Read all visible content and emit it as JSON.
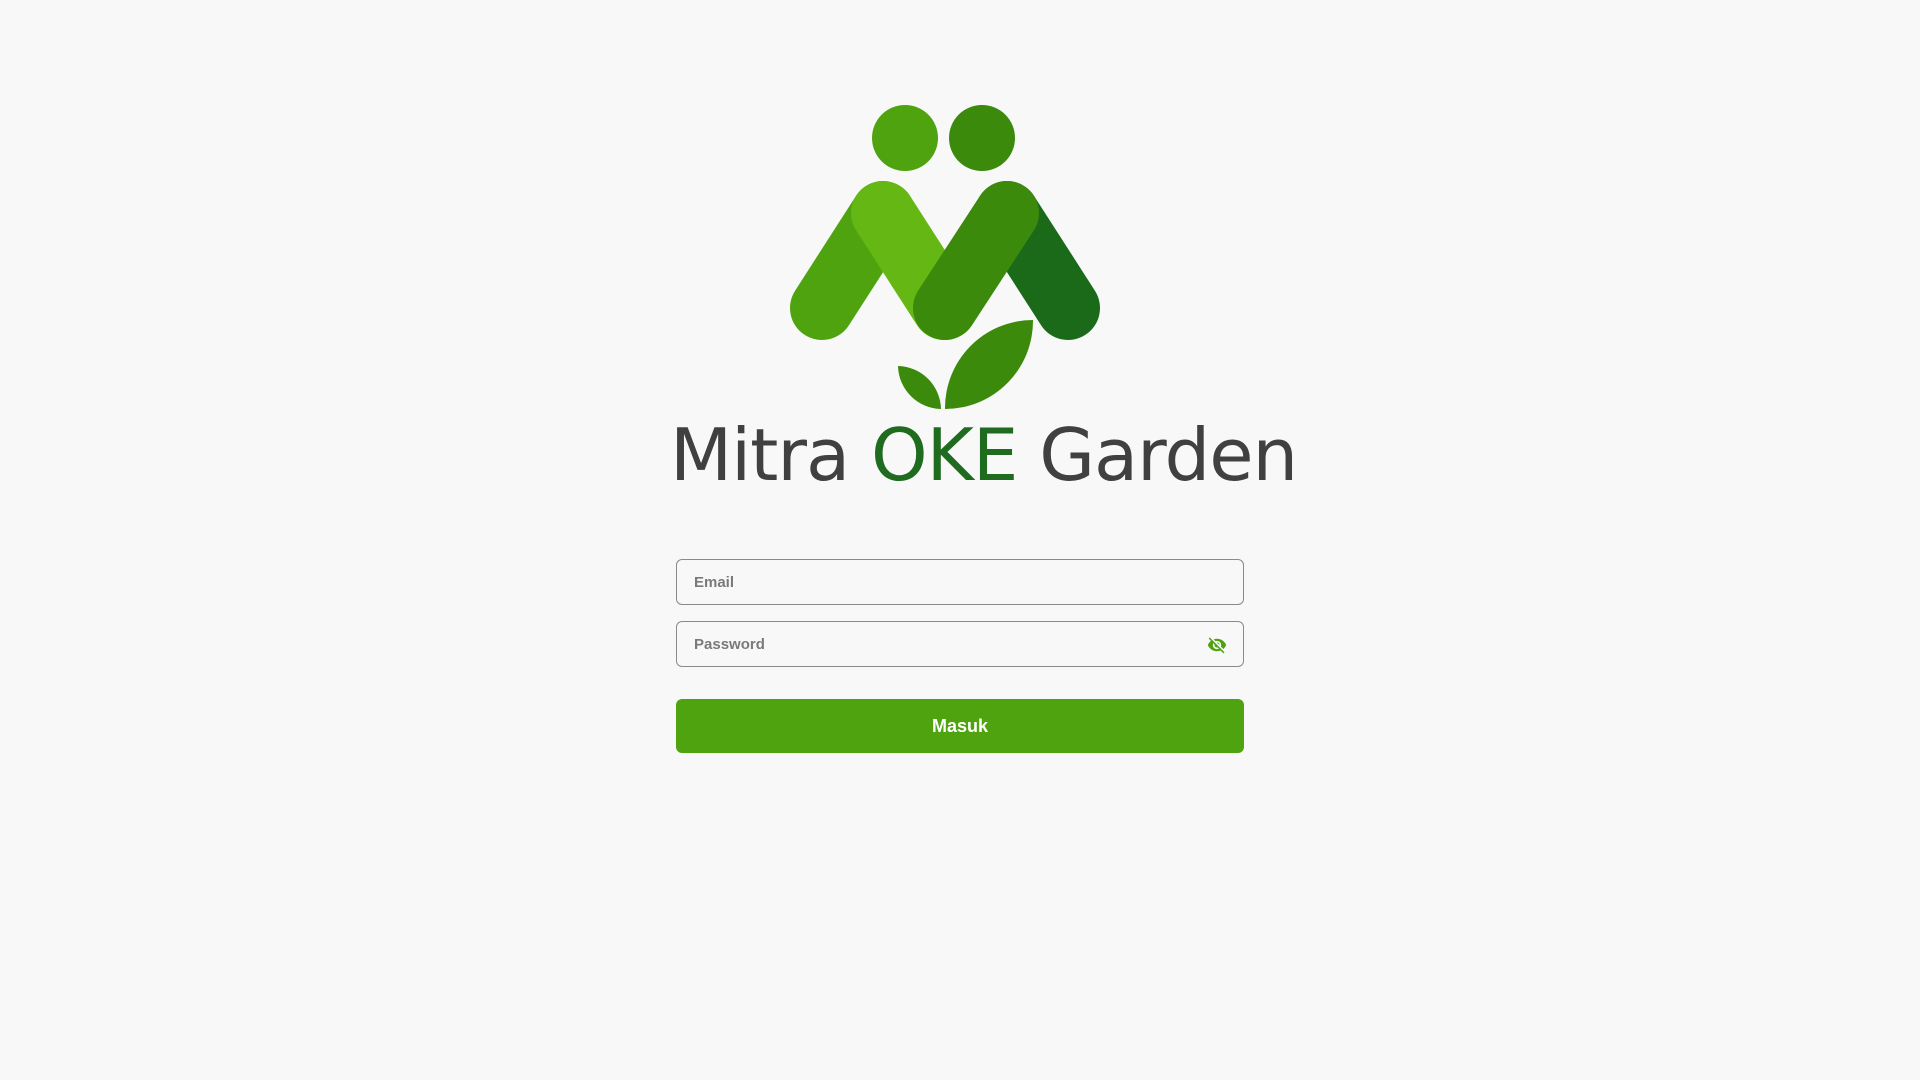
{
  "brand": {
    "name_part1": "Mitra ",
    "name_accent": "OKE",
    "name_part2": " Garden",
    "colors": {
      "light_green": "#65b814",
      "mid_green": "#4fa30f",
      "dark_green": "#3b8a0b",
      "darkest_green": "#1f6b1f",
      "text_gray": "#404040"
    }
  },
  "login": {
    "email_placeholder": "Email",
    "password_placeholder": "Password",
    "password_toggle_icon": "eye-off-icon",
    "submit_label": "Masuk",
    "accent_color": "#4fa30f"
  }
}
